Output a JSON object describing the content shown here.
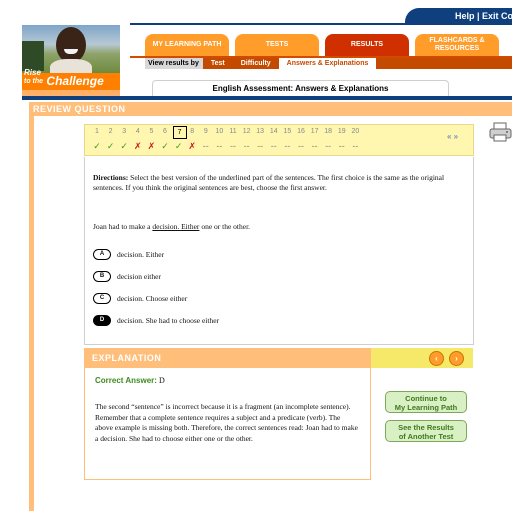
{
  "toplinks": {
    "help": "Help",
    "sep": " | ",
    "exit": "Exit Co"
  },
  "logo": {
    "small": "Rise",
    "tothe": "to the",
    "main": "Challenge"
  },
  "nav": {
    "tabs": [
      {
        "label": "MY LEARNING PATH",
        "active": false
      },
      {
        "label": "TESTS",
        "active": false
      },
      {
        "label": "RESULTS",
        "active": true
      },
      {
        "label": "FLASHCARDS & RESOURCES",
        "active": false
      }
    ],
    "sub": {
      "label": "View results by",
      "items": [
        "Test",
        "Difficulty",
        "Answers & Explanations"
      ],
      "current": 2
    }
  },
  "page_title": "English Assessment: Answers & Explanations",
  "review": {
    "header": "REVIEW QUESTION",
    "numbers": [
      "1",
      "2",
      "3",
      "4",
      "5",
      "6",
      "7",
      "8",
      "9",
      "10",
      "11",
      "12",
      "13",
      "14",
      "15",
      "16",
      "17",
      "18",
      "19",
      "20"
    ],
    "current_index": 6,
    "marks": [
      "✓",
      "✓",
      "✓",
      "✗",
      "✗",
      "✓",
      "✓",
      "✗",
      "--",
      "--",
      "--",
      "--",
      "--",
      "--",
      "--",
      "--",
      "--",
      "--",
      "--",
      "--"
    ],
    "mark_status": [
      "ok",
      "ok",
      "ok",
      "no",
      "no",
      "ok",
      "ok",
      "no",
      "na",
      "na",
      "na",
      "na",
      "na",
      "na",
      "na",
      "na",
      "na",
      "na",
      "na",
      "na"
    ],
    "nav": "« »"
  },
  "question": {
    "directions_label": "Directions:",
    "directions_text": " Select the best version of the underlined part of the sentences. The first choice is the same as the original sentences. If you think the original sentences are best, choose the first answer.",
    "prompt_before": "Joan had to make a ",
    "prompt_underlined": "decision. Either",
    "prompt_after": " one or the other.",
    "choices": [
      {
        "letter": "A",
        "text": "decision. Either",
        "selected": false
      },
      {
        "letter": "B",
        "text": "decision either",
        "selected": false
      },
      {
        "letter": "C",
        "text": "decision. Choose either",
        "selected": false
      },
      {
        "letter": "D",
        "text": "decision. She had to choose either",
        "selected": true
      }
    ]
  },
  "explanation": {
    "header": "EXPLANATION",
    "prev": "‹",
    "next": "›",
    "correct_label": "Correct Answer:",
    "correct_value": " D",
    "text": "The second “sentence” is incorrect because it is a fragment (an incomplete sentence). Remember that a complete sentence requires a subject and a predicate (verb). The above example is missing both. Therefore, the correct sentences read: Joan had to make a decision. She had to choose either one or the other."
  },
  "buttons": {
    "continue_line1": "Continue to",
    "continue_line2": "My Learning Path",
    "results_line1": "See the Results",
    "results_line2": "of Another Test"
  },
  "colors": {
    "orange": "#ff9c2a",
    "navy": "#0f3f7d",
    "peach": "#ffbe7a",
    "green": "#3e9b1a",
    "red": "#d21818"
  }
}
